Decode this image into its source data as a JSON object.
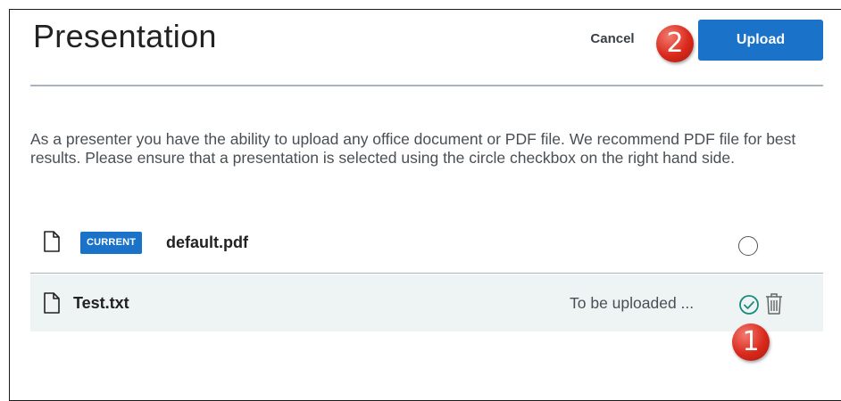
{
  "dialog": {
    "title": "Presentation",
    "cancel_label": "Cancel",
    "upload_label": "Upload",
    "description": "As a presenter you have the ability to upload any office document or PDF file. We recommend PDF file for best results. Please ensure that a presentation is selected using the circle checkbox on the right hand side."
  },
  "files": [
    {
      "name": "default.pdf",
      "badge": "CURRENT",
      "selected": false
    },
    {
      "name": "Test.txt",
      "status": "To be uploaded ...",
      "selected": true
    }
  ],
  "annotations": {
    "step_1": "1",
    "step_2": "2"
  },
  "colors": {
    "primary": "#1b72c9",
    "check": "#1a8a7a",
    "marker": "#d9291c"
  }
}
